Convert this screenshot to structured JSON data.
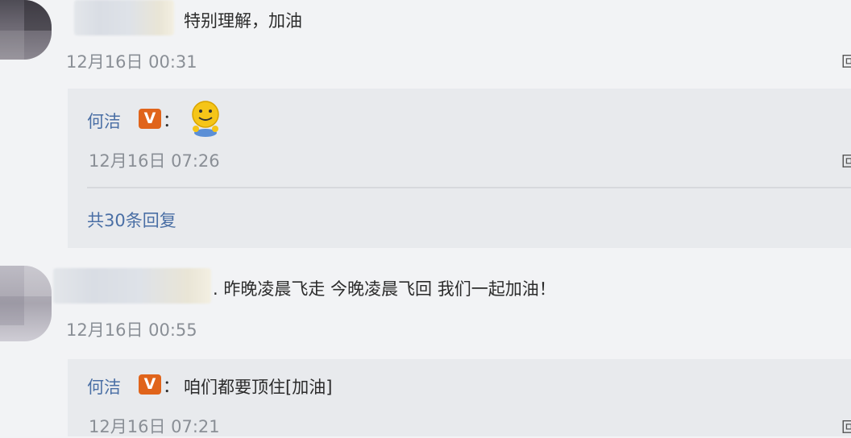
{
  "comments": [
    {
      "text": "特别理解，加油",
      "timestamp": "12月16日 00:31",
      "reply": {
        "author": "何洁",
        "badge": "V",
        "separator": "：",
        "content_emoji": "smiley-emoji",
        "timestamp": "12月16日 07:26"
      },
      "more_replies": "共30条回复"
    },
    {
      "text": ". 昨晚凌晨飞走 今晚凌晨飞回 我们一起加油！",
      "timestamp": "12月16日 00:55",
      "reply": {
        "author": "何洁",
        "badge": "V",
        "separator": "：",
        "content": "咱们都要顶住[加油]",
        "timestamp": "12月16日 07:21"
      }
    }
  ],
  "reply_button_glyph": "回",
  "colors": {
    "background": "#f2f3f5",
    "reply_panel": "#e8eaed",
    "link_blue": "#4a6fa5",
    "verified_badge": "#e0641b",
    "timestamp_gray": "#8a8f96"
  }
}
